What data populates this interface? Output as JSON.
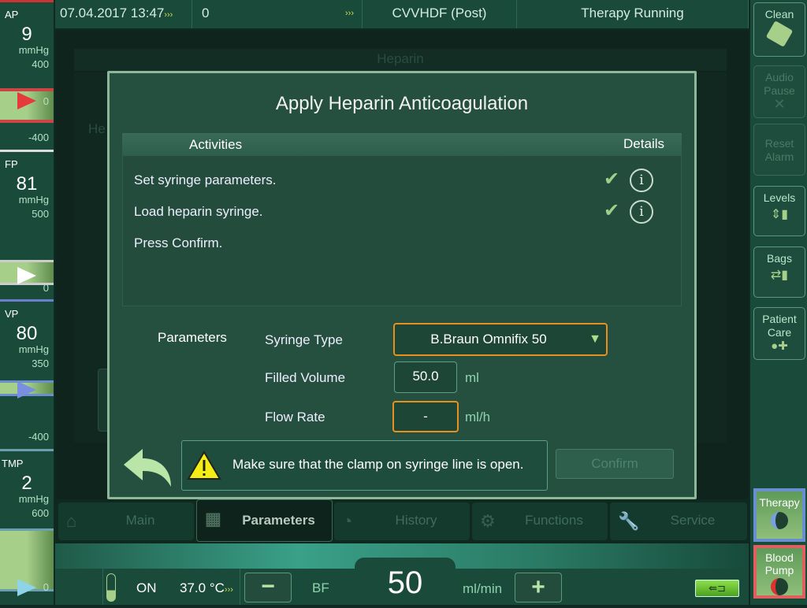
{
  "gauges": [
    {
      "label": "AP",
      "value": "9",
      "unit": "mmHg",
      "ticks": [
        "400",
        "0",
        "-400"
      ],
      "arrow_color": "#e63b3b"
    },
    {
      "label": "FP",
      "value": "81",
      "unit": "mmHg",
      "ticks": [
        "500",
        "0"
      ],
      "arrow_color": "#ffffff"
    },
    {
      "label": "VP",
      "value": "80",
      "unit": "mmHg",
      "ticks": [
        "350",
        "-400"
      ],
      "arrow_color": "#7a8fe0"
    },
    {
      "label": "TMP",
      "value": "2",
      "unit": "mmHg",
      "ticks": [
        "600",
        "0"
      ],
      "arrow_color": "#8fd3e8"
    }
  ],
  "topbar": {
    "datetime": "07.04.2017 13:47",
    "counter": "0",
    "mode": "CVVHDF (Post)",
    "status": "Therapy Running"
  },
  "right_buttons": [
    {
      "label": "Clean",
      "icon": "hand-wipe-icon",
      "enabled": true
    },
    {
      "label": "Audio Pause",
      "icon": "bell-crossed-icon",
      "enabled": false
    },
    {
      "label": "Reset Alarm",
      "enabled": false
    },
    {
      "label": "Levels",
      "icon": "levels-icon",
      "enabled": true
    },
    {
      "label": "Bags",
      "icon": "bag-change-icon",
      "enabled": true
    },
    {
      "label": "Patient Care",
      "icon": "patient-care-icon",
      "enabled": true
    },
    {
      "label": "Therapy",
      "icon": "pump-icon"
    },
    {
      "label": "Blood Pump",
      "icon": "pump-icon"
    }
  ],
  "background_dialog": {
    "title": "Heparin",
    "partial_text": "He"
  },
  "dialog": {
    "title": "Apply Heparin Anticoagulation",
    "columns": {
      "activities": "Activities",
      "details": "Details"
    },
    "activities": [
      {
        "text": "Set syringe parameters.",
        "done": true
      },
      {
        "text": "Load heparin syringe.",
        "done": true
      },
      {
        "text": "Press Confirm.",
        "done": false
      }
    ],
    "parameters_label": "Parameters",
    "syringe_type": {
      "label": "Syringe Type",
      "value": "B.Braun Omnifix 50"
    },
    "filled_volume": {
      "label": "Filled Volume",
      "value": "50.0",
      "unit": "ml"
    },
    "flow_rate": {
      "label": "Flow Rate",
      "value": "-",
      "unit": "ml/h"
    },
    "warning": "Make sure that the clamp on syringe line is open.",
    "confirm": "Confirm",
    "accent": "#e8901e"
  },
  "tabs": [
    {
      "label": "Main",
      "icon": "home-icon"
    },
    {
      "label": "Parameters",
      "icon": "calculator-icon",
      "active": true
    },
    {
      "label": "History",
      "icon": "history-icon"
    },
    {
      "label": "Functions",
      "icon": "gear-icon"
    },
    {
      "label": "Service",
      "icon": "wrench-icon"
    }
  ],
  "bottombar": {
    "heater": "ON",
    "temperature": "37.0",
    "temp_unit": "°C",
    "bf_label": "BF",
    "bf_value": "50",
    "bf_unit": "ml/min",
    "minus": "−",
    "plus": "+"
  }
}
